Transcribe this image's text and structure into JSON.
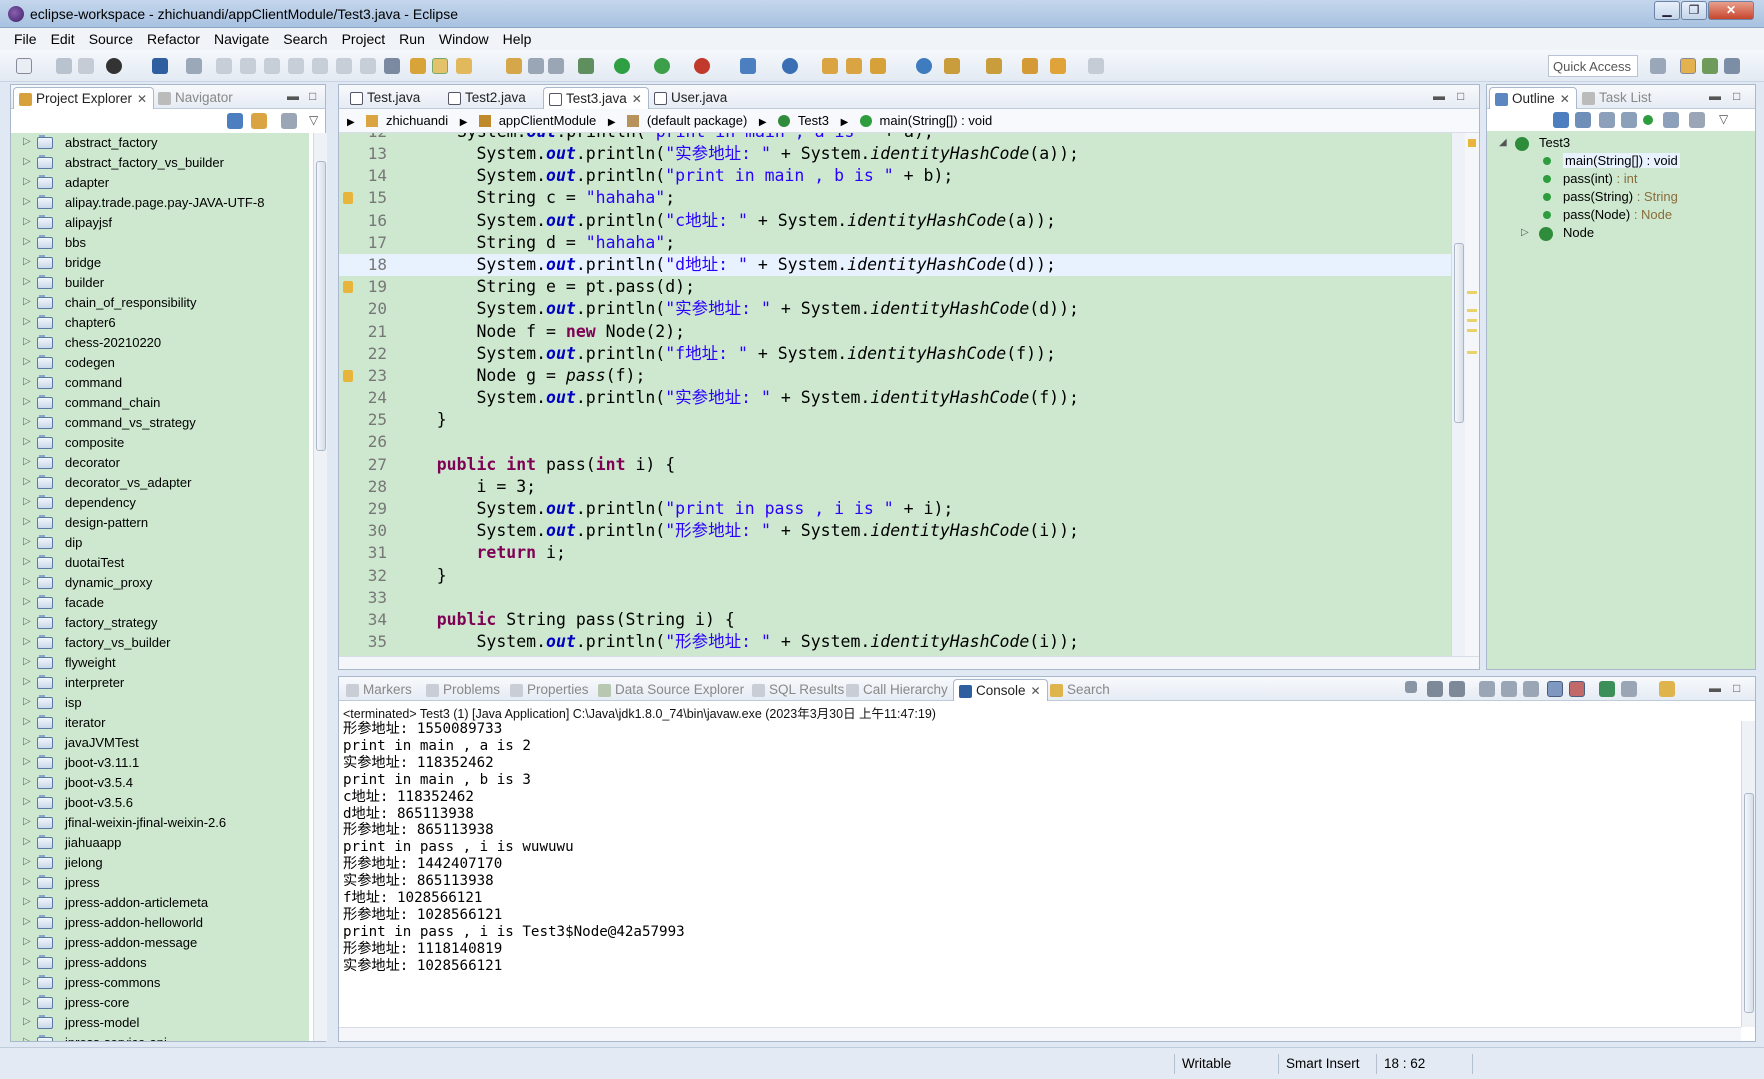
{
  "window": {
    "title": "eclipse-workspace - zhichuandi/appClientModule/Test3.java - Eclipse"
  },
  "menu": [
    "File",
    "Edit",
    "Source",
    "Refactor",
    "Navigate",
    "Search",
    "Project",
    "Run",
    "Window",
    "Help"
  ],
  "toolbar": {
    "quick_access": "Quick Access"
  },
  "project_explorer": {
    "tab_label": "Project Explorer",
    "navigator_label": "Navigator",
    "items": [
      "abstract_factory",
      "abstract_factory_vs_builder",
      "adapter",
      "alipay.trade.page.pay-JAVA-UTF-8",
      "alipayjsf",
      "bbs",
      "bridge",
      "builder",
      "chain_of_responsibility",
      "chapter6",
      "chess-20210220",
      "codegen",
      "command",
      "command_chain",
      "command_vs_strategy",
      "composite",
      "decorator",
      "decorator_vs_adapter",
      "dependency",
      "design-pattern",
      "dip",
      "duotaiTest",
      "dynamic_proxy",
      "facade",
      "factory_strategy",
      "factory_vs_builder",
      "flyweight",
      "interpreter",
      "isp",
      "iterator",
      "javaJVMTest",
      "jboot-v3.11.1",
      "jboot-v3.5.4",
      "jboot-v3.5.6",
      "jfinal-weixin-jfinal-weixin-2.6",
      "jiahuaapp",
      "jielong",
      "jpress",
      "jpress-addon-articlemeta",
      "jpress-addon-helloworld",
      "jpress-addon-message",
      "jpress-addons",
      "jpress-commons",
      "jpress-core",
      "jpress-model",
      "jpress-service-api"
    ]
  },
  "editor": {
    "tabs": [
      "Test.java",
      "Test2.java",
      "Test3.java",
      "User.java"
    ],
    "active_tab": "Test3.java",
    "breadcrumb": [
      "zhichuandi",
      "appClientModule",
      "(default package)",
      "Test3",
      "main(String[]) : void"
    ]
  },
  "outline": {
    "tab_label": "Outline",
    "tasklist_label": "Task List",
    "class_name": "Test3",
    "members": [
      {
        "name": "main(String[]) : void",
        "ret": ""
      },
      {
        "name": "pass(int)",
        "ret": " : int"
      },
      {
        "name": "pass(String)",
        "ret": " : String"
      },
      {
        "name": "pass(Node)",
        "ret": " : Node"
      },
      {
        "name": "Node",
        "ret": ""
      }
    ]
  },
  "bottom_tabs": [
    "Markers",
    "Problems",
    "Properties",
    "Data Source Explorer",
    "SQL Results",
    "Call Hierarchy",
    "Console",
    "Search"
  ],
  "console": {
    "path": "<terminated> Test3 (1) [Java Application] C:\\Java\\jdk1.8.0_74\\bin\\javaw.exe (2023年3月30日 上午11:47:19)",
    "lines": [
      "形参地址: 1550089733",
      "print in main , a is 2",
      "实参地址: 118352462",
      "print in main , b is 3",
      "c地址: 118352462",
      "d地址: 865113938",
      "形参地址: 865113938",
      "print in pass , i is wuwuwu",
      "形参地址: 1442407170",
      "实参地址: 865113938",
      "f地址: 1028566121",
      "形参地址: 1028566121",
      "print in pass , i is Test3$Node@42a57993",
      "形参地址: 1118140819",
      "实参地址: 1028566121"
    ]
  },
  "status": {
    "writable": "Writable",
    "insert": "Smart Insert",
    "position": "18 : 62"
  }
}
